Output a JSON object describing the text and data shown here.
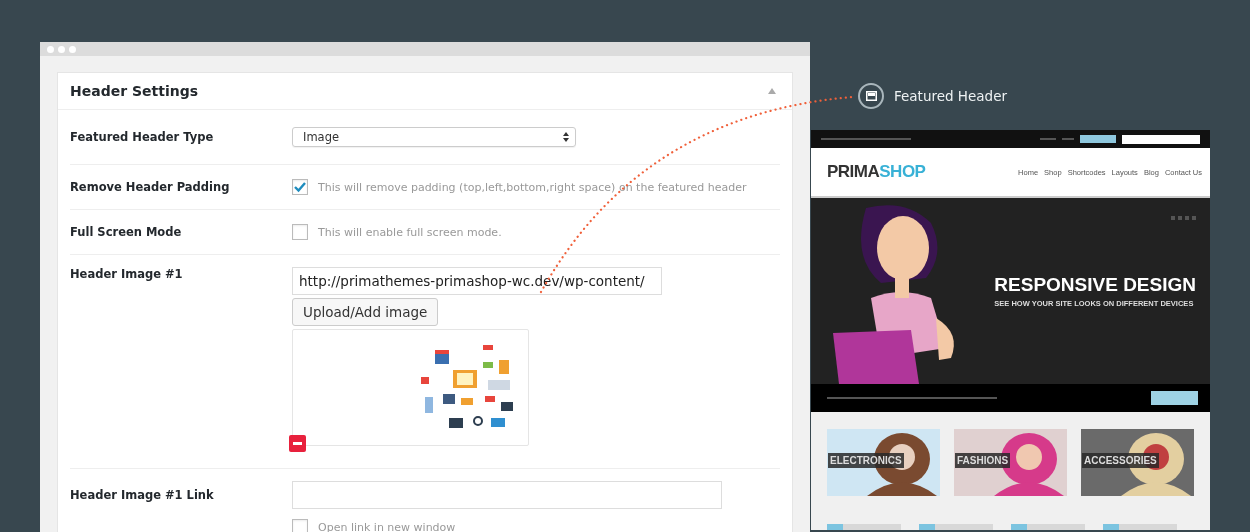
{
  "settings_panel": {
    "title": "Header Settings",
    "rows": [
      {
        "kind": "select",
        "label": "Featured Header Type",
        "value": "Image"
      },
      {
        "kind": "checkbox",
        "label": "Remove Header Padding",
        "checked": true,
        "description": "This will remove padding (top,left,bottom,right space) on the featured header"
      },
      {
        "kind": "checkbox",
        "label": "Full Screen Mode",
        "checked": false,
        "description": "This will enable full screen mode."
      },
      {
        "label": "Header Image #1",
        "value": "http://primathemes-primashop-wc.dev/wp-content/",
        "button": "Upload/Add image"
      },
      {
        "kind": "link",
        "label": "Header Image #1 Link",
        "option": {
          "label": "Open link in new window",
          "checked": false
        }
      }
    ]
  },
  "callout": {
    "label": "Featured Header"
  },
  "preview": {
    "logo_dark": "PRIMA",
    "logo_accent": "SHOP",
    "nav": [
      "Home",
      "Shop",
      "Shortcodes",
      "Layouts",
      "Blog",
      "Contact Us"
    ],
    "hero_title": "RESPONSIVE DESIGN",
    "hero_subtitle": "SEE HOW YOUR SITE LOOKS ON DIFFERENT DEVICES",
    "categories": [
      "ELECTRONICS",
      "FASHIONS",
      "ACCESSORIES"
    ]
  }
}
